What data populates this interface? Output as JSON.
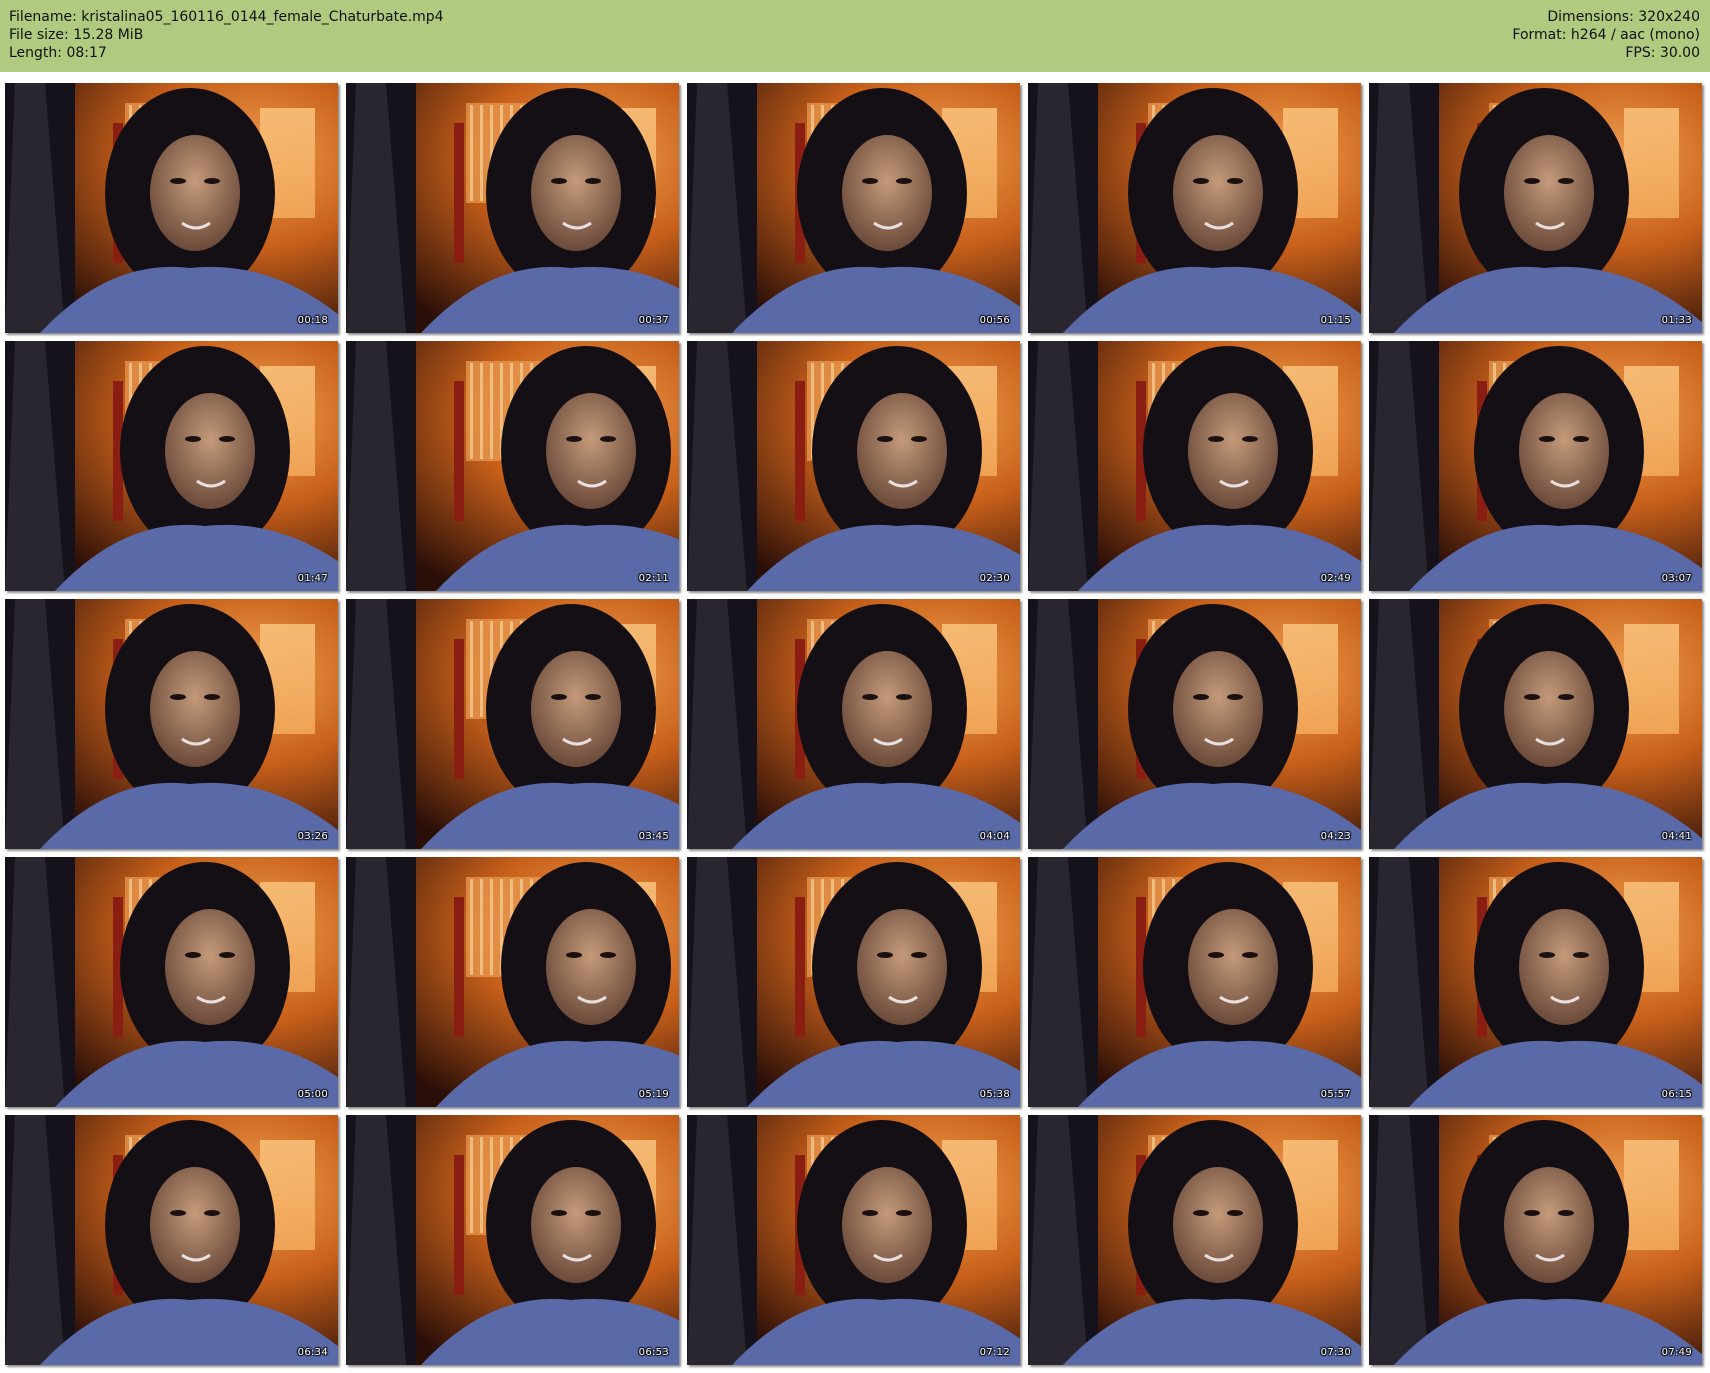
{
  "header": {
    "filename": "Filename: kristalina05_160116_0144_female_Chaturbate.mp4",
    "filesize": "File size: 15.28 MiB",
    "length": "Length: 08:17",
    "dimensions": "Dimensions: 320x240",
    "format": "Format: h264 / aac (mono)",
    "fps": "FPS: 30.00"
  },
  "thumbnails": [
    {
      "time": "00:18"
    },
    {
      "time": "00:37"
    },
    {
      "time": "00:56"
    },
    {
      "time": "01:15"
    },
    {
      "time": "01:33"
    },
    {
      "time": "01:47"
    },
    {
      "time": "02:11"
    },
    {
      "time": "02:30"
    },
    {
      "time": "02:49"
    },
    {
      "time": "03:07"
    },
    {
      "time": "03:26"
    },
    {
      "time": "03:45"
    },
    {
      "time": "04:04"
    },
    {
      "time": "04:23"
    },
    {
      "time": "04:41"
    },
    {
      "time": "05:00"
    },
    {
      "time": "05:19"
    },
    {
      "time": "05:38"
    },
    {
      "time": "05:57"
    },
    {
      "time": "06:15"
    },
    {
      "time": "06:34"
    },
    {
      "time": "06:53"
    },
    {
      "time": "07:12"
    },
    {
      "time": "07:30"
    },
    {
      "time": "07:49"
    }
  ],
  "colors": {
    "header_background": "#b0cb7f",
    "room_orange": "#c8601a",
    "window_glow": "#f2a85a",
    "shirt_blue": "#5a6aa8",
    "hair": "#140f14"
  }
}
